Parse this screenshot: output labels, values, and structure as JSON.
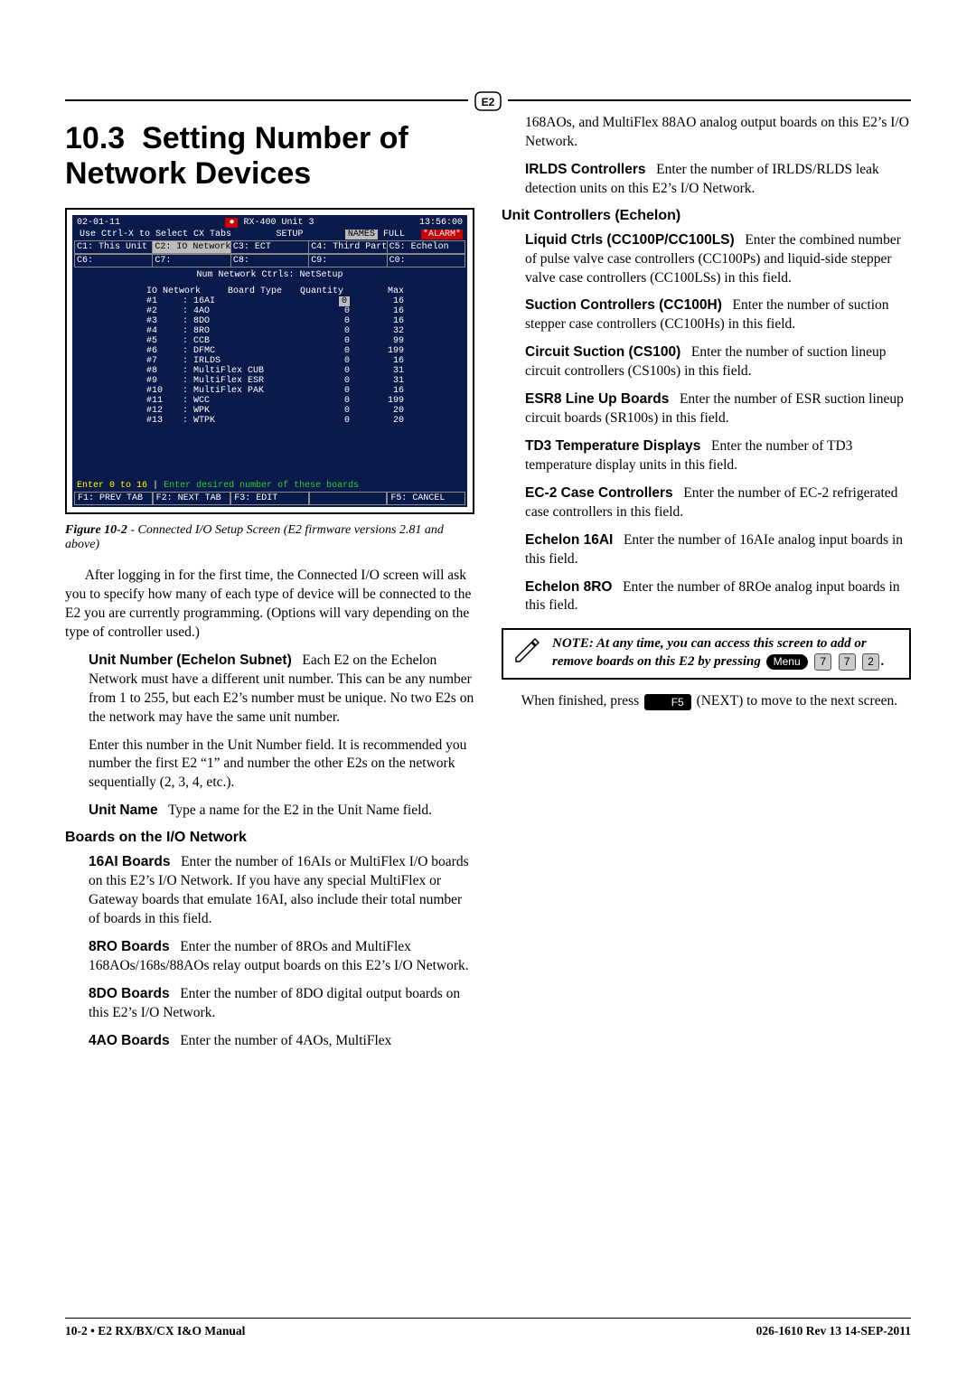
{
  "header_symbol": "E2",
  "section_number": "10.3",
  "section_title": "Setting Number of Network Devices",
  "screencap": {
    "date": "02-01-11",
    "unit_label": "RX-400 Unit 3",
    "time": "13:56:00",
    "ctrlx_hint": "Use Ctrl-X to Select CX Tabs",
    "setup_label": "SETUP",
    "names_label": "NAMES",
    "full_label": "FULL",
    "alarm_label": "*ALARM*",
    "tabs_row1": [
      "C1: This Unit",
      "C2: IO Network",
      "C3: ECT",
      "C4: Third Party",
      "C5: Echelon"
    ],
    "tabs_row2": [
      "C6:",
      "C7:",
      "C8:",
      "C9:",
      "C0:"
    ],
    "screen_title": "Num Network Ctrls: NetSetup",
    "col_headers": [
      "IO Network",
      "Board Type",
      "Quantity",
      "Max"
    ],
    "rows": [
      {
        "n": "#1",
        "type": "16AI",
        "qty": "0",
        "max": "16",
        "sel": true
      },
      {
        "n": "#2",
        "type": "4AO",
        "qty": "0",
        "max": "16"
      },
      {
        "n": "#3",
        "type": "8DO",
        "qty": "0",
        "max": "16"
      },
      {
        "n": "#4",
        "type": "8RO",
        "qty": "0",
        "max": "32"
      },
      {
        "n": "#5",
        "type": "CCB",
        "qty": "0",
        "max": "99"
      },
      {
        "n": "#6",
        "type": "DFMC",
        "qty": "0",
        "max": "199"
      },
      {
        "n": "#7",
        "type": "IRLDS",
        "qty": "0",
        "max": "16"
      },
      {
        "n": "#8",
        "type": "MultiFlex CUB",
        "qty": "0",
        "max": "31"
      },
      {
        "n": "#9",
        "type": "MultiFlex ESR",
        "qty": "0",
        "max": "31"
      },
      {
        "n": "#10",
        "type": "MultiFlex PAK",
        "qty": "0",
        "max": "16"
      },
      {
        "n": "#11",
        "type": "WCC",
        "qty": "0",
        "max": "199"
      },
      {
        "n": "#12",
        "type": "WPK",
        "qty": "0",
        "max": "20"
      },
      {
        "n": "#13",
        "type": "WTPK",
        "qty": "0",
        "max": "20"
      }
    ],
    "hint_left": "Enter 0 to 16",
    "hint_sep": "|",
    "hint_right": "Enter desired number of these boards",
    "fkeys": [
      "F1: PREV TAB",
      "F2: NEXT TAB",
      "F3: EDIT",
      "",
      "F5: CANCEL"
    ]
  },
  "fig_label": "Figure 10-2",
  "fig_caption": " - Connected I/O Setup Screen (E2 firmware versions 2.81 and above)",
  "para_intro": "After logging in for the first time, the Connected I/O screen will ask you to specify how many of each type of device will be connected to the E2 you are currently programming. (Options will vary depending on the type of controller used.)",
  "entries_left": [
    {
      "title": "Unit Number (Echelon Subnet)",
      "text": "Each E2 on the Echelon Network must have a different unit number. This can be any number from 1 to 255, but each E2’s number must be unique. No two E2s on the network may have the same unit number."
    },
    {
      "title": "",
      "text": "Enter this number in the Unit Number field. It is recommended you number the first E2 “1” and number the other E2s on the network sequentially (2, 3, 4, etc.)."
    },
    {
      "title": "Unit Name",
      "text": "Type a name for the E2 in the Unit Name field."
    }
  ],
  "sub_ionet": "Boards on the I/O Network",
  "entries_ionet": [
    {
      "title": "16AI Boards",
      "text": "Enter the number of 16AIs or MultiFlex I/O boards on this E2’s I/O Network. If you have any special MultiFlex or Gateway boards that emulate 16AI, also include their total number of boards in this field."
    },
    {
      "title": "8RO Boards",
      "text": "Enter the number of 8ROs and MultiFlex 168AOs/168s/88AOs relay output boards on this E2’s I/O Network."
    },
    {
      "title": "8DO Boards",
      "text": "Enter the number of 8DO digital output boards on this E2’s I/O Network."
    },
    {
      "title": "4AO Boards",
      "text": "Enter the number of 4AOs, MultiFlex"
    }
  ],
  "entries_right_top": [
    {
      "title": "",
      "text": "168AOs, and MultiFlex 88AO analog output boards on this E2’s I/O Network."
    },
    {
      "title": "IRLDS Controllers",
      "text": "Enter the number of IRLDS/RLDS leak detection units on this E2’s I/O Network."
    }
  ],
  "sub_echelon": "Unit Controllers (Echelon)",
  "entries_echelon": [
    {
      "title": "Liquid Ctrls (CC100P/CC100LS)",
      "text": "Enter the combined number of pulse valve case controllers (CC100Ps) and liquid-side stepper valve case controllers (CC100LSs) in this field."
    },
    {
      "title": "Suction Controllers (CC100H)",
      "text": "Enter the number of suction stepper case controllers (CC100Hs) in this field."
    },
    {
      "title": "Circuit Suction (CS100)",
      "text": "Enter the number of suction lineup circuit controllers (CS100s) in this field."
    },
    {
      "title": "ESR8 Line Up Boards",
      "text": "Enter the number of ESR suction lineup circuit boards (SR100s) in this field."
    },
    {
      "title": "TD3 Temperature Displays",
      "text": "Enter the number of TD3 temperature display units in this field."
    },
    {
      "title": "EC-2 Case Controllers",
      "text": "Enter the number of EC-2 refrigerated case controllers in this field."
    },
    {
      "title": "Echelon 16AI",
      "text": "Enter the number of 16AIe analog input boards in this field."
    },
    {
      "title": "Echelon 8RO",
      "text": "Enter the number of 8ROe analog input boards in this field."
    }
  ],
  "note_text": "NOTE: At any time, you can access this screen to add or remove boards on this E2 by pressing ",
  "note_keys": {
    "menu": "Menu",
    "k1": "7",
    "k2": "7",
    "k3": "2"
  },
  "final_para_pre": "When finished, press ",
  "final_key": "F5",
  "final_para_post": " (NEXT) to move to the next screen.",
  "footer_left": "10-2 • E2 RX/BX/CX I&O Manual",
  "footer_right": "026-1610 Rev 13 14-SEP-2011"
}
